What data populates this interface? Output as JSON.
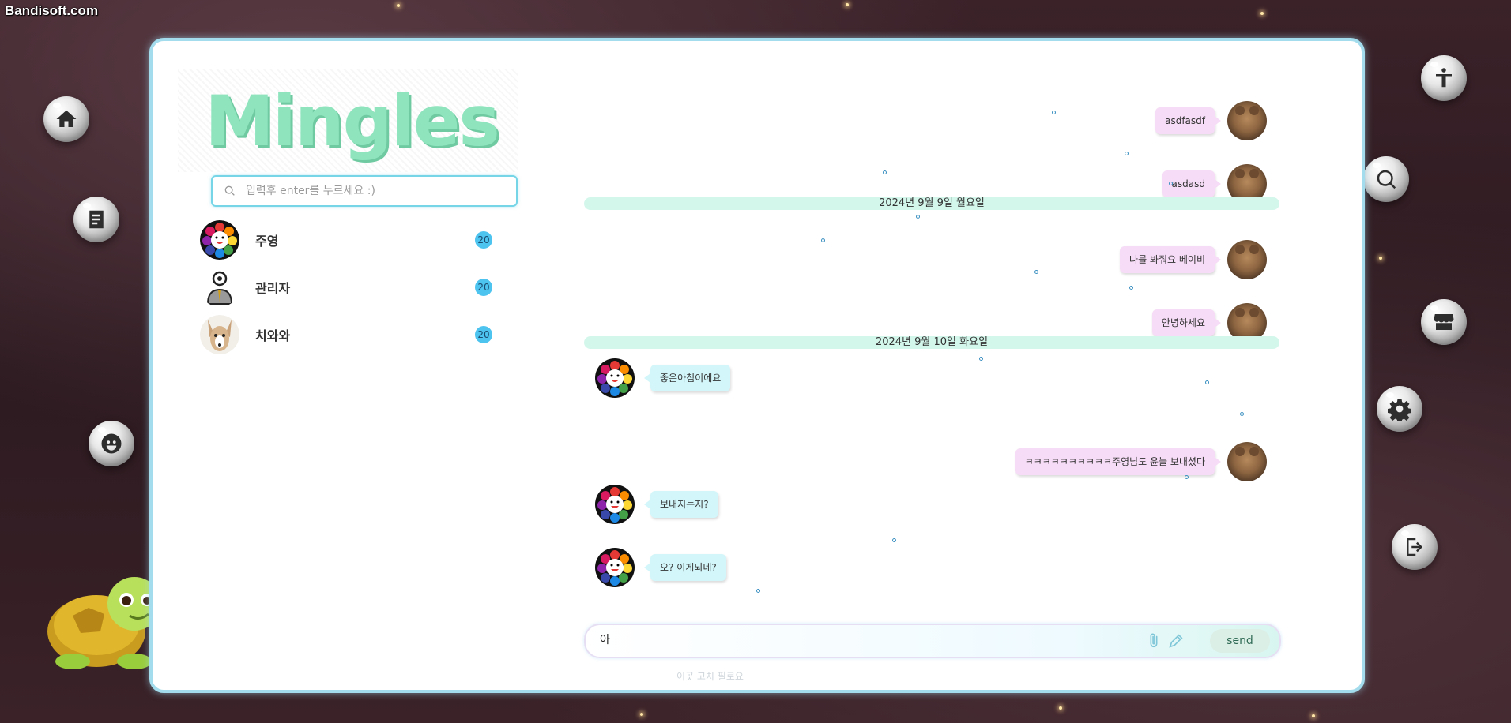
{
  "watermark": "Bandisoft.com",
  "logo": "Mingles",
  "search": {
    "placeholder": "입력후 enter를 누르세요 :)"
  },
  "friends": [
    {
      "name": "주영",
      "count": "20"
    },
    {
      "name": "관리자",
      "count": "20"
    },
    {
      "name": "치와와",
      "count": "20"
    }
  ],
  "chat": {
    "messages_top": [
      {
        "side": "right",
        "text": "asdfasdf"
      },
      {
        "side": "right",
        "text": "asdasd"
      }
    ],
    "date1": "2024년 9월 9일 월요일",
    "messages_mid": [
      {
        "side": "right",
        "text": "나를 봐줘요 베이비"
      },
      {
        "side": "right",
        "text": "안녕하세요"
      }
    ],
    "date2": "2024년 9월 10일 화요일",
    "messages_bottom": [
      {
        "side": "left",
        "text": "좋은아침이에요"
      },
      {
        "side": "right",
        "text": "ㅋㅋㅋㅋㅋㅋㅋㅋㅋㅋ주영님도 윤늘 보내셨다"
      },
      {
        "side": "left",
        "text": "보내지는지?"
      },
      {
        "side": "left",
        "text": "오? 이게되네?"
      }
    ]
  },
  "composer": {
    "value": "아",
    "send_label": "send",
    "hint": "이곳 고치 필로요"
  },
  "left_nav": [
    "home-icon",
    "document-icon",
    "smile-icon"
  ],
  "right_nav": [
    "accessibility-icon",
    "search-globe-icon",
    "store-icon",
    "settings-icon",
    "logout-icon"
  ],
  "colors": {
    "card_border": "#a3dcec",
    "accent_mint": "#8fe4be",
    "bubble_right": "#f6dcf6",
    "bubble_left": "#d3f6fa",
    "date_bar": "#d4f7ec",
    "badge": "#4dc3ef"
  }
}
